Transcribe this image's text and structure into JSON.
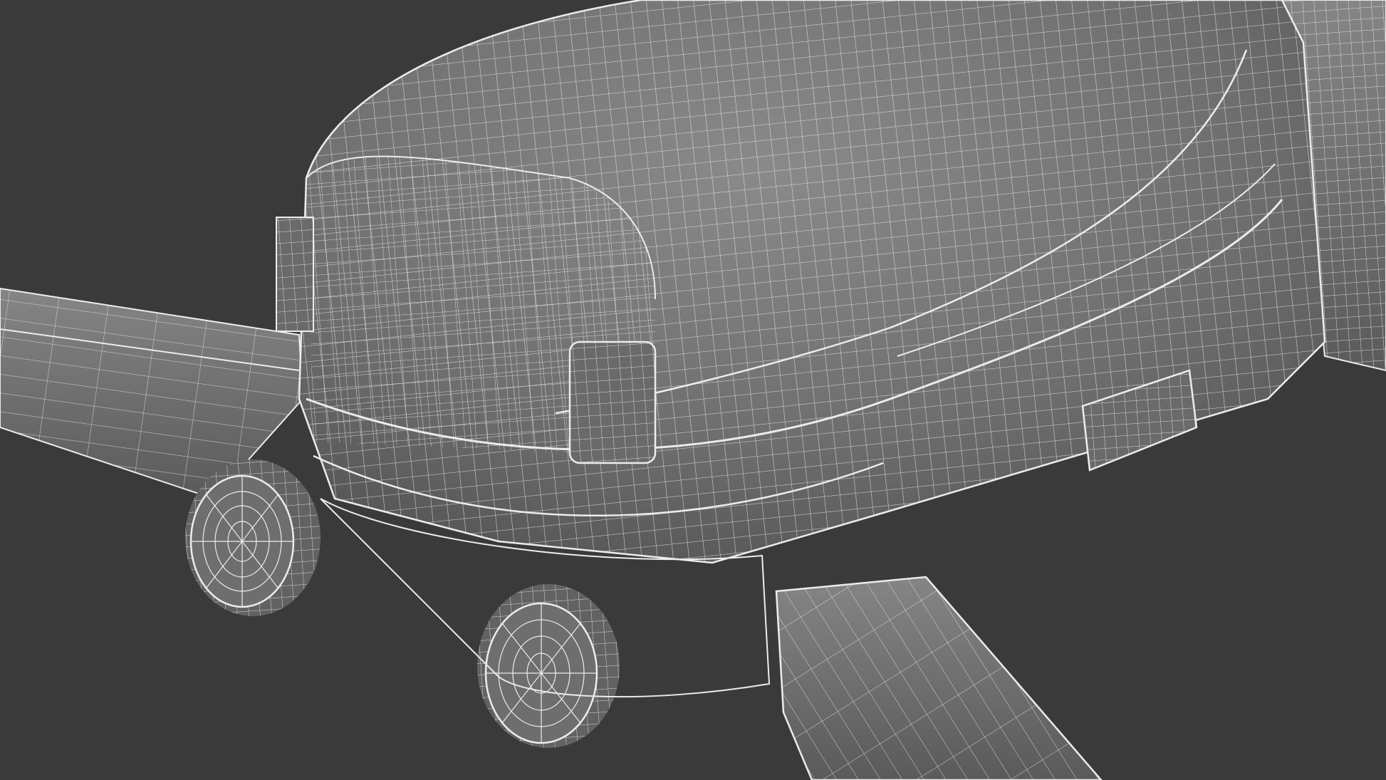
{
  "scene": {
    "background_color": "#3a3a3a",
    "surface_color": "#6e6e6e",
    "surface_highlight": "#8a8a8a",
    "surface_shadow": "#505050",
    "wire_color": "#ececec",
    "visible_text": []
  }
}
